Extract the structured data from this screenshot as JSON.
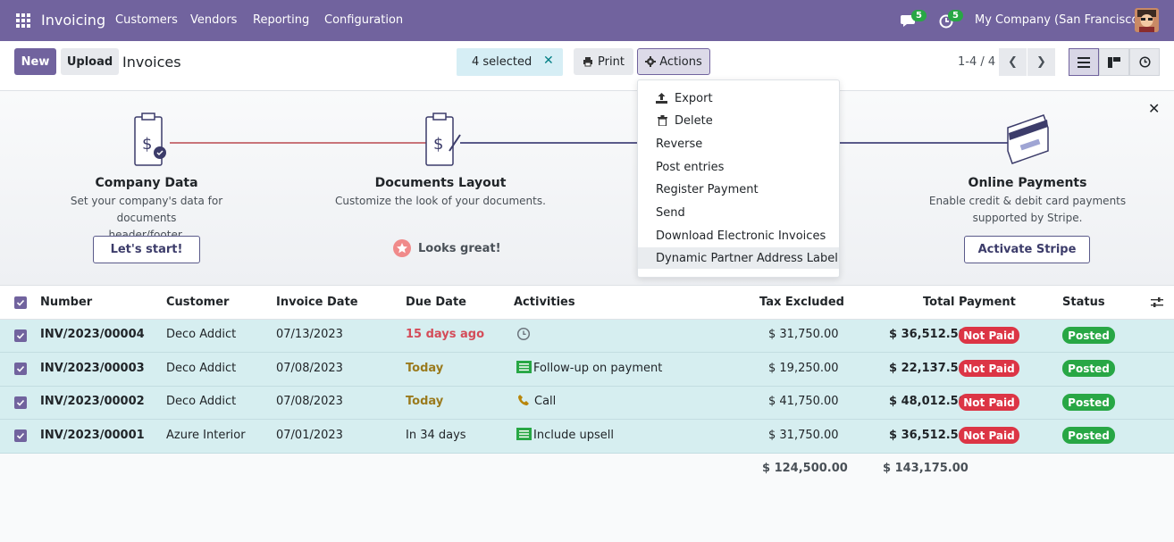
{
  "topbar": {
    "app_title": "Invoicing",
    "nav": [
      "Customers",
      "Vendors",
      "Reporting",
      "Configuration"
    ],
    "messages_count": "5",
    "activities_count": "5",
    "company": "My Company (San Francisco)"
  },
  "control": {
    "new_label": "New",
    "upload_label": "Upload",
    "breadcrumb": "Invoices",
    "selected_label": "4 selected",
    "print_label": "Print",
    "actions_label": "Actions",
    "pager": "1-4 / 4"
  },
  "banner": {
    "steps": [
      {
        "title": "Company Data",
        "desc1": "Set your company's data for documents",
        "desc2": "header/footer.",
        "button": "Let's start!"
      },
      {
        "title": "Documents Layout",
        "desc1": "Customize the look of your documents.",
        "desc2": "",
        "done": "Looks great!"
      },
      {
        "title": "Online Payments",
        "desc1": "Enable credit & debit card payments",
        "desc2": "supported by Stripe.",
        "button": "Activate Stripe"
      }
    ]
  },
  "actions_menu": [
    "Export",
    "Delete",
    "Reverse",
    "Post entries",
    "Register Payment",
    "Send",
    "Download Electronic Invoices",
    "Dynamic Partner Address Label"
  ],
  "table": {
    "headers": [
      "Number",
      "Customer",
      "Invoice Date",
      "Due Date",
      "Activities",
      "Tax Excluded",
      "Total",
      "Payment",
      "Status"
    ],
    "rows": [
      {
        "number": "INV/2023/00004",
        "customer": "Deco Addict",
        "date": "07/13/2023",
        "due": "15 days ago",
        "activity": "",
        "activity_icon": "clock-icon",
        "tax_excluded": "$ 31,750.00",
        "total": "$ 36,512.50",
        "payment": "Not Paid",
        "status": "Posted"
      },
      {
        "number": "INV/2023/00003",
        "customer": "Deco Addict",
        "date": "07/08/2023",
        "due": "Today",
        "activity": "Follow-up on payment",
        "activity_icon": "list-icon",
        "tax_excluded": "$ 19,250.00",
        "total": "$ 22,137.50",
        "payment": "Not Paid",
        "status": "Posted"
      },
      {
        "number": "INV/2023/00002",
        "customer": "Deco Addict",
        "date": "07/08/2023",
        "due": "Today",
        "activity": "Call",
        "activity_icon": "phone-icon",
        "tax_excluded": "$ 41,750.00",
        "total": "$ 48,012.50",
        "payment": "Not Paid",
        "status": "Posted"
      },
      {
        "number": "INV/2023/00001",
        "customer": "Azure Interior",
        "date": "07/01/2023",
        "due": "In 34 days",
        "activity": "Include upsell",
        "activity_icon": "list-icon",
        "tax_excluded": "$ 31,750.00",
        "total": "$ 36,512.50",
        "payment": "Not Paid",
        "status": "Posted"
      }
    ],
    "total_tax_excluded": "$ 124,500.00",
    "total_total": "$ 143,175.00"
  },
  "colors": {
    "brand": "#71639e",
    "selected_row": "#d6eef0",
    "not_paid": "#dc3545",
    "posted": "#28a745"
  }
}
